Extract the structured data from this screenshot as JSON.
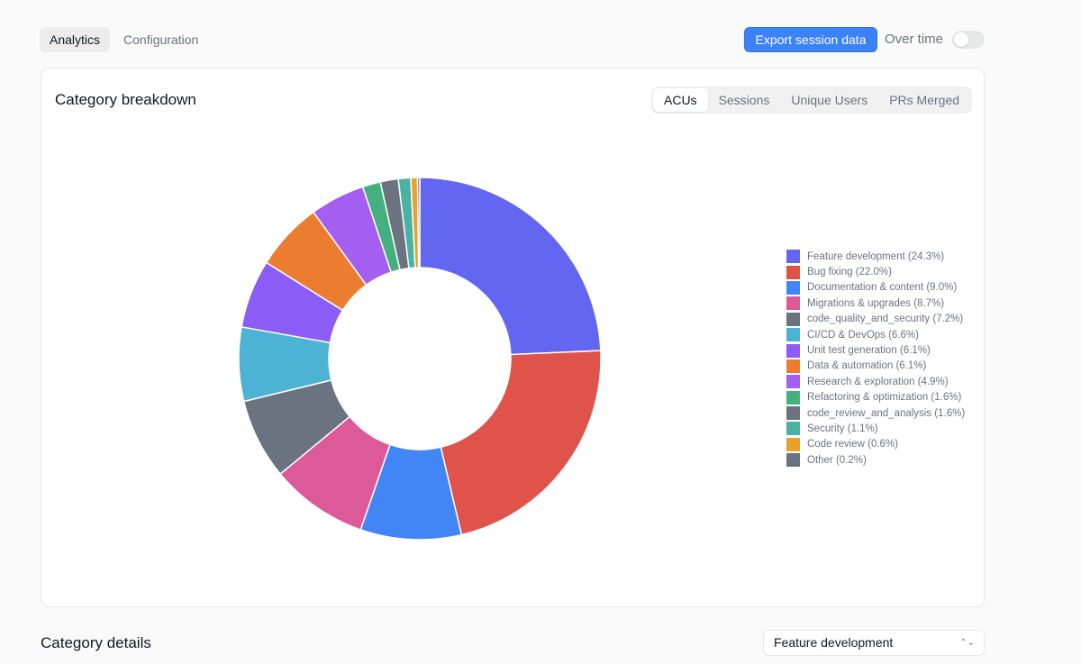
{
  "top_tabs": [
    {
      "label": "Analytics",
      "active": true
    },
    {
      "label": "Configuration",
      "active": false
    }
  ],
  "header": {
    "export_label": "Export session data",
    "over_time_label": "Over time",
    "over_time_enabled": false
  },
  "card": {
    "title": "Category breakdown",
    "metric_tabs": [
      {
        "label": "ACUs",
        "active": true
      },
      {
        "label": "Sessions",
        "active": false
      },
      {
        "label": "Unique Users",
        "active": false
      },
      {
        "label": "PRs Merged",
        "active": false
      }
    ]
  },
  "chart_data": {
    "type": "pie",
    "donut": true,
    "legend_position": "right",
    "slices": [
      {
        "label": "Feature development (24.3%)",
        "value": 24.3,
        "color": "#6366f1"
      },
      {
        "label": "Bug fixing (22.0%)",
        "value": 22.0,
        "color": "#e0534a"
      },
      {
        "label": "Documentation & content (9.0%)",
        "value": 9.0,
        "color": "#4285f4"
      },
      {
        "label": "Migrations & upgrades (8.7%)",
        "value": 8.7,
        "color": "#dd5a9a"
      },
      {
        "label": "code_quality_and_security (7.2%)",
        "value": 7.2,
        "color": "#6b7280"
      },
      {
        "label": "CI/CD & DevOps (6.6%)",
        "value": 6.6,
        "color": "#4cb3d4"
      },
      {
        "label": "Unit test generation (6.1%)",
        "value": 6.1,
        "color": "#8b5cf6"
      },
      {
        "label": "Data & automation (6.1%)",
        "value": 6.1,
        "color": "#ec7d30"
      },
      {
        "label": "Research & exploration (4.9%)",
        "value": 4.9,
        "color": "#a45ef0"
      },
      {
        "label": "Refactoring & optimization (1.6%)",
        "value": 1.6,
        "color": "#45b07f"
      },
      {
        "label": "code_review_and_analysis (1.6%)",
        "value": 1.6,
        "color": "#6b7280"
      },
      {
        "label": "Security (1.1%)",
        "value": 1.1,
        "color": "#49b2a3"
      },
      {
        "label": "Code review (0.6%)",
        "value": 0.6,
        "color": "#e8a12c"
      },
      {
        "label": "Other (0.2%)",
        "value": 0.2,
        "color": "#6b7280"
      }
    ]
  },
  "details": {
    "title": "Category details",
    "selected_category": "Feature development"
  }
}
